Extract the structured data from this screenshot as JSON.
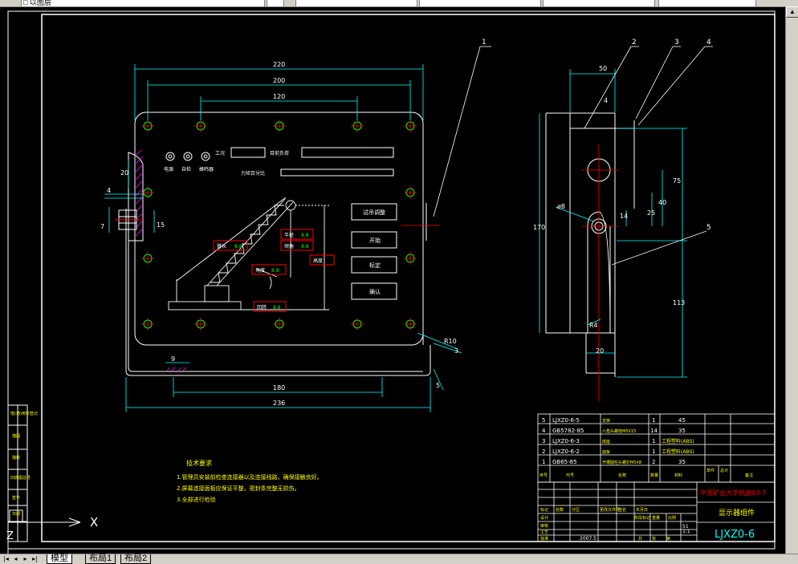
{
  "app": {
    "toolbar_fields": [
      "□  以图层",
      "",
      "",
      "",
      "",
      ""
    ],
    "tabs": [
      "模型",
      "布局1",
      "布局2"
    ],
    "nav_buttons": [
      "|◂",
      "◂",
      "▸",
      "▸|"
    ],
    "ucs": {
      "x_label": "X",
      "z_label": "Z"
    }
  },
  "drawing": {
    "dims_front": {
      "d220": "220",
      "d200": "200",
      "d120": "120",
      "d4": "4",
      "d7": "7",
      "d15": "15",
      "d20": "20",
      "d9": "9",
      "d180": "180",
      "d236": "236",
      "r10": "R10",
      "d3": "3",
      "d5": "5"
    },
    "dims_side": {
      "d50": "50",
      "d4": "4",
      "d75": "75",
      "d40": "40",
      "d25": "25",
      "d14": "14",
      "d170": "170",
      "d113": "113",
      "d8": "ø8",
      "r4": "R4",
      "d20": "20"
    },
    "balloons": [
      "1",
      "2",
      "3",
      "4",
      "5"
    ],
    "panel": {
      "indicators": [
        "电源",
        "自检",
        "蜂鸣器"
      ],
      "lbl_gongkuang": "工况",
      "lbl_liju": "力矩百分比",
      "lbl_ratio": "目前负荷",
      "readouts": {
        "armlen": "臂长",
        "radius": "半径",
        "angle": "角度",
        "height": "高度",
        "tilt": "倾角",
        "swing": "回转"
      },
      "digits": "8.8",
      "buttons": [
        "试吊调整",
        "开始",
        "标定",
        "确认"
      ]
    },
    "tech_title": "技术要求",
    "tech_notes": [
      "1.管理员安装前检查连接器以及连接线路，确保接触良好。",
      "2.屏幕连接面板应保证平整，密封条完整无损伤。",
      "3.全部进行检验"
    ],
    "left_strip": [
      "借(通)用件登记",
      "描图",
      "描校",
      "旧底图总号",
      "签字",
      "日期"
    ],
    "bom": [
      {
        "no": "5",
        "code": "LJXZ0-6-5",
        "name": "支架",
        "qty": "1",
        "mat": "45",
        "note": ""
      },
      {
        "no": "4",
        "code": "GB5782-85",
        "name": "六角头螺栓M5X15",
        "qty": "14",
        "mat": "35",
        "note": ""
      },
      {
        "no": "3",
        "code": "LJXZ0-6-3",
        "name": "底座",
        "qty": "1",
        "mat": "工程塑料(ABS)",
        "note": ""
      },
      {
        "no": "2",
        "code": "LJXZ0-6-2",
        "name": "面板",
        "qty": "1",
        "mat": "工程塑料(ABS)",
        "note": ""
      },
      {
        "no": "1",
        "code": "GB65-85",
        "name": "开槽圆柱头螺钉M5X8",
        "qty": "2",
        "mat": "35",
        "note": ""
      }
    ],
    "bom_header": [
      "序号",
      "代号",
      "名称",
      "数量",
      "材料",
      "单件",
      "总计",
      "备注"
    ],
    "title_block": {
      "school": "中国矿业大学机自03-7",
      "part": "显示器组件",
      "drawing_no": "LJXZ0-6",
      "scale": "1:1",
      "sheet": "51",
      "date": "2007.5",
      "small": [
        "设计",
        "审核",
        "工艺",
        "批准",
        "标记",
        "处数",
        "分区",
        "更改文件号",
        "签名",
        "年月日",
        "阶段标记",
        "重量",
        "比例",
        "共",
        "张",
        "第"
      ]
    }
  }
}
